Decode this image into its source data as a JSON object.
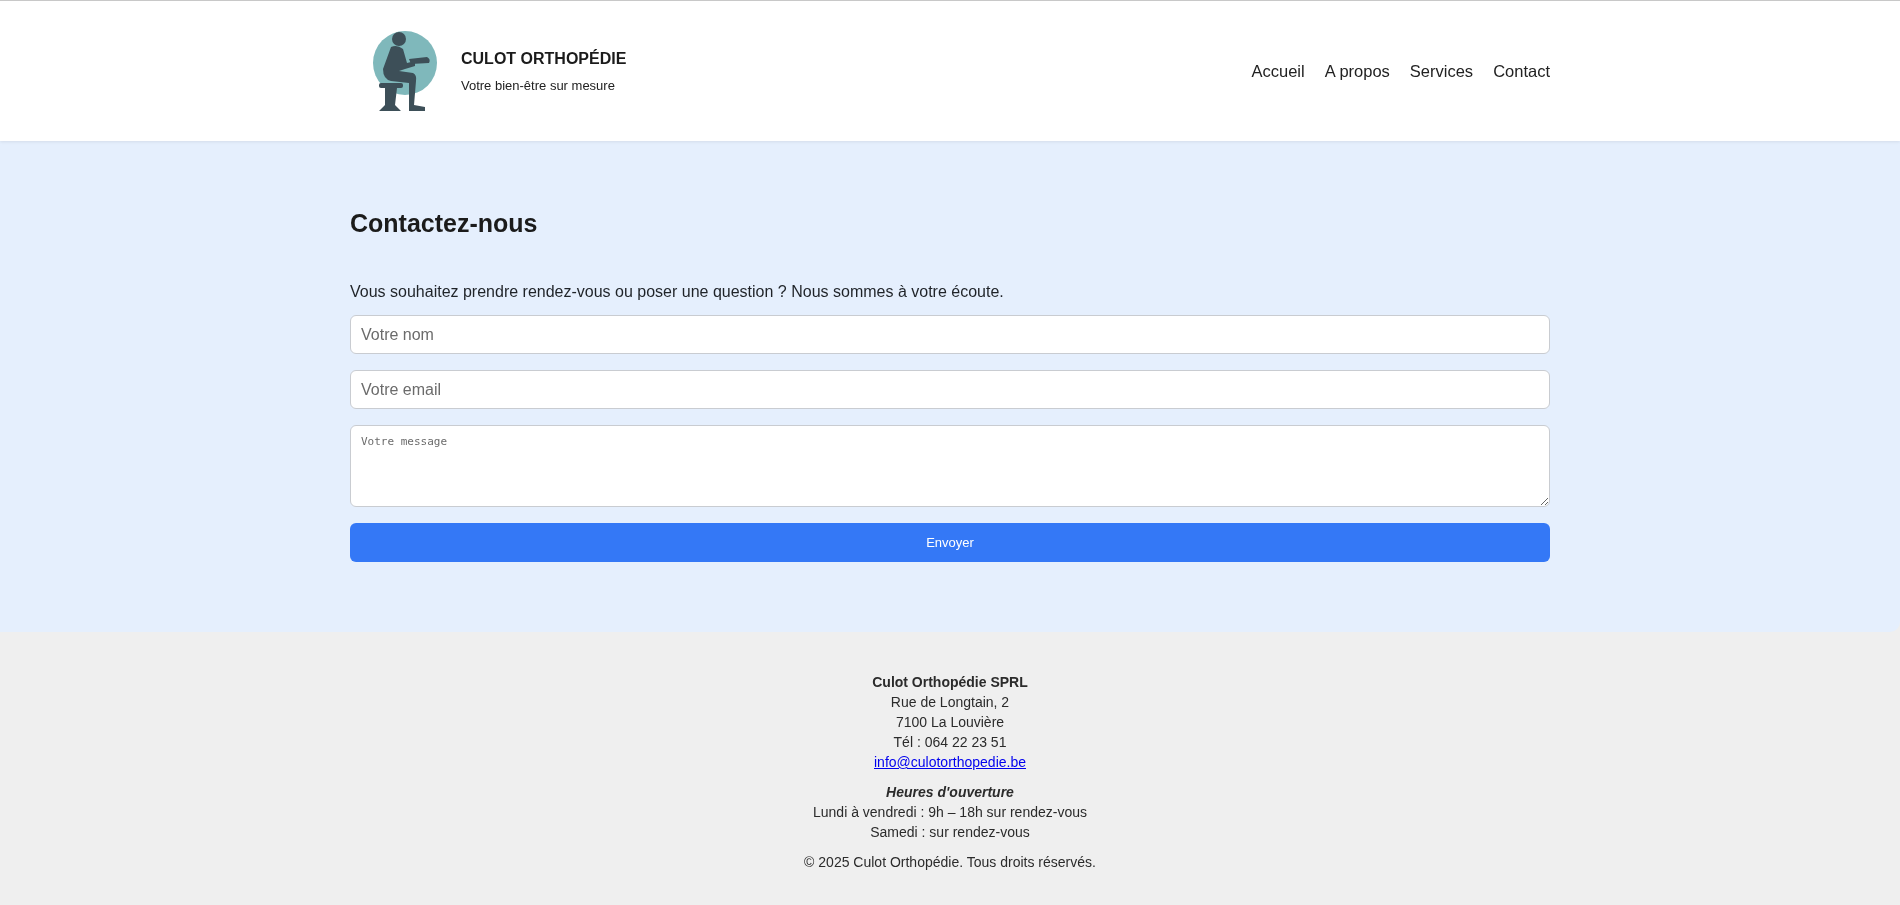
{
  "header": {
    "brand_title": "CULOT ORTHOPÉDIE",
    "brand_tagline": "Votre bien-être sur mesure",
    "nav": [
      {
        "label": "Accueil"
      },
      {
        "label": "A propos"
      },
      {
        "label": "Services"
      },
      {
        "label": "Contact"
      }
    ]
  },
  "contact": {
    "heading": "Contactez-nous",
    "intro": "Vous souhaitez prendre rendez-vous ou poser une question ? Nous sommes à votre écoute.",
    "fields": [
      {
        "kind": "input",
        "placeholder": "Votre nom"
      },
      {
        "kind": "input",
        "placeholder": "Votre email"
      },
      {
        "kind": "textarea",
        "placeholder": "Votre message"
      }
    ],
    "submit": "Envoyer"
  },
  "footer": {
    "company": "Culot Orthopédie SPRL",
    "address": [
      "Rue de Longtain, 2",
      "7100 La Louvière",
      "Tél : 064 22 23 51"
    ],
    "email": "info@culotorthopedie.be",
    "hours_title": "Heures d'ouverture",
    "hours": [
      "Lundi à vendredi : 9h – 18h sur rendez-vous",
      "Samedi : sur rendez-vous"
    ],
    "copyright": "© 2025 Culot Orthopédie. Tous droits réservés."
  }
}
